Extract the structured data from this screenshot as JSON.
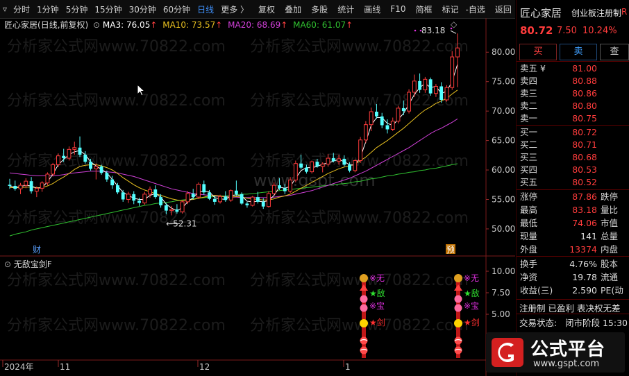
{
  "toolbar": {
    "items": [
      {
        "label": "分时",
        "active": false
      },
      {
        "label": "1分钟",
        "active": false
      },
      {
        "label": "5分钟",
        "active": false
      },
      {
        "label": "15分钟",
        "active": false
      },
      {
        "label": "30分钟",
        "active": false
      },
      {
        "label": "60分钟",
        "active": false
      },
      {
        "label": "日线",
        "active": true
      },
      {
        "label": "更多 〉",
        "active": false
      }
    ],
    "right_items": [
      "复权",
      "叠加",
      "多股",
      "统计",
      "画线",
      "F10",
      "简框",
      "标记",
      "-自选",
      "返回"
    ]
  },
  "chart_header": {
    "stock": "匠心家居",
    "mode": "(日线,前复权)",
    "ma3": "MA3: 76.05",
    "ma10": "MA10: 73.57",
    "ma20": "MA20: 68.69",
    "ma60": "MA60: 61.07",
    "colors": {
      "ma3": "#ffffff",
      "ma10": "#e8c020",
      "ma20": "#d040d8",
      "ma60": "#30c030"
    }
  },
  "chart_data": {
    "type": "candlestick",
    "y_ticks": [
      "80.00",
      "75.00",
      "70.00",
      "65.00",
      "60.00",
      "55.00",
      "50.00"
    ],
    "ylim": [
      45.4,
      85.8
    ],
    "annotations": {
      "high": "83.18",
      "low": "52.31"
    },
    "x_ticks": [
      "2024年",
      "11",
      "12",
      "1"
    ],
    "markers": {
      "fin": "财",
      "pre": "预"
    },
    "ohlc": [
      [
        57.5,
        58.5,
        56.8,
        57.3
      ],
      [
        57.3,
        58.2,
        56.5,
        56.8
      ],
      [
        56.8,
        57.8,
        55.9,
        57.4
      ],
      [
        57.4,
        58.6,
        56.9,
        58.1
      ],
      [
        58.1,
        58.8,
        56.0,
        56.4
      ],
      [
        56.4,
        57.2,
        55.4,
        56.9
      ],
      [
        56.9,
        58.1,
        56.3,
        57.8
      ],
      [
        57.8,
        59.6,
        57.4,
        59.3
      ],
      [
        59.3,
        61.2,
        58.9,
        60.9
      ],
      [
        60.9,
        62.8,
        60.5,
        62.4
      ],
      [
        62.4,
        63.6,
        61.4,
        62.0
      ],
      [
        62.0,
        64.0,
        61.6,
        63.5
      ],
      [
        63.5,
        64.8,
        62.6,
        63.8
      ],
      [
        63.8,
        65.7,
        62.2,
        62.6
      ],
      [
        62.6,
        63.2,
        61.1,
        61.4
      ],
      [
        61.4,
        61.9,
        59.9,
        60.2
      ],
      [
        60.2,
        61.1,
        58.4,
        60.6
      ],
      [
        60.6,
        60.9,
        59.2,
        59.5
      ],
      [
        59.5,
        59.9,
        58.0,
        58.4
      ],
      [
        58.4,
        59.0,
        56.8,
        57.4
      ],
      [
        57.4,
        57.8,
        55.9,
        56.2
      ],
      [
        56.2,
        56.6,
        54.6,
        55.0
      ],
      [
        55.0,
        56.3,
        54.4,
        55.9
      ],
      [
        55.9,
        56.4,
        54.2,
        54.8
      ],
      [
        54.8,
        55.3,
        53.9,
        54.4
      ],
      [
        54.4,
        56.3,
        54.1,
        55.9
      ],
      [
        55.9,
        57.2,
        55.3,
        56.7
      ],
      [
        56.7,
        57.4,
        55.1,
        55.4
      ],
      [
        55.4,
        55.9,
        53.6,
        54.0
      ],
      [
        54.0,
        54.4,
        52.5,
        53.1
      ],
      [
        53.1,
        53.9,
        52.3,
        53.3
      ],
      [
        53.3,
        54.2,
        52.6,
        52.9
      ],
      [
        52.9,
        54.9,
        52.6,
        54.6
      ],
      [
        54.6,
        56.4,
        54.2,
        56.0
      ],
      [
        56.0,
        56.8,
        55.0,
        55.4
      ],
      [
        55.4,
        57.9,
        55.1,
        57.6
      ],
      [
        57.6,
        58.2,
        55.8,
        56.2
      ],
      [
        56.2,
        56.6,
        54.9,
        55.1
      ],
      [
        55.1,
        55.6,
        54.1,
        54.6
      ],
      [
        54.6,
        55.8,
        54.3,
        55.5
      ],
      [
        55.5,
        56.4,
        54.6,
        54.9
      ],
      [
        54.9,
        56.7,
        54.6,
        56.5
      ],
      [
        56.5,
        58.2,
        55.6,
        55.9
      ],
      [
        55.9,
        56.2,
        54.1,
        54.3
      ],
      [
        54.3,
        54.6,
        53.6,
        54.0
      ],
      [
        54.0,
        55.6,
        53.8,
        55.4
      ],
      [
        55.4,
        56.3,
        54.3,
        54.6
      ],
      [
        54.6,
        55.2,
        53.4,
        53.8
      ],
      [
        53.8,
        56.4,
        53.6,
        56.0
      ],
      [
        56.0,
        57.9,
        55.8,
        57.4
      ],
      [
        57.4,
        58.6,
        56.6,
        56.9
      ],
      [
        56.9,
        57.6,
        55.9,
        56.4
      ],
      [
        56.4,
        58.8,
        56.1,
        58.3
      ],
      [
        58.3,
        61.6,
        57.9,
        61.1
      ],
      [
        61.1,
        62.6,
        60.1,
        60.4
      ],
      [
        60.4,
        60.9,
        59.4,
        59.7
      ],
      [
        59.7,
        61.6,
        59.4,
        61.4
      ],
      [
        61.4,
        61.9,
        60.4,
        60.6
      ],
      [
        60.6,
        61.3,
        59.6,
        61.0
      ],
      [
        61.0,
        62.7,
        60.6,
        62.0
      ],
      [
        62.0,
        62.9,
        61.3,
        61.5
      ],
      [
        61.5,
        62.6,
        60.9,
        61.9
      ],
      [
        61.9,
        62.5,
        60.6,
        60.9
      ],
      [
        60.9,
        61.3,
        59.6,
        59.9
      ],
      [
        59.9,
        61.8,
        59.6,
        61.6
      ],
      [
        61.6,
        65.6,
        61.2,
        65.1
      ],
      [
        65.1,
        68.3,
        64.6,
        67.7
      ],
      [
        67.7,
        70.6,
        66.6,
        69.9
      ],
      [
        69.9,
        71.2,
        68.7,
        69.1
      ],
      [
        69.1,
        69.7,
        67.1,
        67.6
      ],
      [
        67.6,
        68.6,
        66.2,
        66.9
      ],
      [
        66.9,
        68.9,
        66.6,
        68.3
      ],
      [
        68.3,
        70.9,
        67.9,
        70.5
      ],
      [
        70.5,
        71.8,
        69.3,
        70.0
      ],
      [
        70.0,
        73.7,
        69.6,
        73.2
      ],
      [
        73.2,
        76.2,
        72.4,
        75.1
      ],
      [
        75.1,
        76.4,
        73.1,
        73.6
      ],
      [
        73.6,
        75.8,
        73.1,
        75.4
      ],
      [
        75.4,
        75.7,
        72.6,
        73.0
      ],
      [
        73.0,
        74.6,
        72.4,
        74.2
      ],
      [
        74.2,
        74.9,
        71.4,
        71.9
      ],
      [
        71.9,
        74.4,
        71.6,
        74.0
      ],
      [
        74.0,
        80.2,
        73.6,
        79.2
      ],
      [
        79.2,
        83.18,
        74.06,
        80.72
      ]
    ],
    "ma_series": {
      "ma3": [
        57.3,
        57.0,
        57.2,
        57.4,
        57.3,
        56.9,
        57.0,
        58.0,
        59.3,
        60.9,
        61.8,
        62.6,
        63.1,
        63.3,
        62.6,
        61.4,
        60.7,
        60.1,
        59.5,
        58.4,
        57.3,
        56.2,
        55.7,
        55.2,
        55.0,
        55.0,
        55.7,
        56.0,
        55.4,
        54.2,
        53.5,
        53.1,
        53.6,
        54.6,
        55.3,
        56.3,
        56.4,
        56.3,
        55.3,
        55.1,
        55.0,
        55.6,
        55.8,
        55.6,
        54.7,
        54.6,
        54.7,
        54.6,
        54.8,
        55.7,
        57.1,
        56.9,
        57.2,
        58.6,
        59.9,
        60.4,
        60.4,
        60.6,
        61.0,
        61.2,
        61.5,
        61.8,
        61.4,
        60.9,
        60.8,
        62.2,
        64.8,
        67.6,
        68.9,
        68.9,
        67.9,
        67.6,
        68.6,
        69.6,
        71.2,
        72.8,
        74.0,
        74.7,
        74.0,
        74.2,
        73.0,
        73.4,
        75.0,
        77.97
      ],
      "ma10": [
        57.0,
        57.0,
        57.0,
        57.1,
        57.1,
        57.0,
        57.0,
        57.3,
        57.7,
        58.3,
        58.8,
        59.4,
        60.1,
        60.6,
        60.8,
        60.9,
        60.9,
        60.7,
        60.4,
        60.0,
        59.4,
        58.7,
        58.1,
        57.5,
        57.0,
        56.6,
        56.3,
        56.0,
        55.7,
        55.4,
        55.1,
        54.9,
        54.8,
        54.9,
        55.0,
        55.2,
        55.4,
        55.6,
        55.7,
        55.6,
        55.4,
        55.4,
        55.5,
        55.4,
        55.2,
        55.1,
        55.0,
        54.9,
        54.9,
        55.1,
        55.4,
        55.6,
        55.9,
        56.4,
        56.9,
        57.4,
        57.9,
        58.4,
        58.9,
        59.4,
        59.8,
        60.2,
        60.5,
        60.7,
        61.0,
        61.6,
        62.2,
        63.0,
        63.8,
        64.4,
        65.0,
        65.7,
        66.4,
        67.1,
        67.9,
        68.7,
        69.5,
        70.2,
        70.7,
        71.3,
        71.7,
        72.2,
        72.9,
        73.57
      ],
      "ma20": [
        59.5,
        59.4,
        59.3,
        59.2,
        59.1,
        59.0,
        59.0,
        59.0,
        59.0,
        59.1,
        59.2,
        59.4,
        59.5,
        59.6,
        59.7,
        59.8,
        59.8,
        59.8,
        59.7,
        59.6,
        59.5,
        59.3,
        59.1,
        58.9,
        58.6,
        58.3,
        58.0,
        57.7,
        57.4,
        57.1,
        56.8,
        56.6,
        56.4,
        56.2,
        56.0,
        55.9,
        55.8,
        55.7,
        55.6,
        55.5,
        55.5,
        55.4,
        55.4,
        55.3,
        55.3,
        55.3,
        55.3,
        55.3,
        55.3,
        55.4,
        55.5,
        55.6,
        55.7,
        55.9,
        56.1,
        56.3,
        56.5,
        56.8,
        57.1,
        57.4,
        57.7,
        58.0,
        58.3,
        58.6,
        59.0,
        59.4,
        59.8,
        60.3,
        60.8,
        61.3,
        61.8,
        62.3,
        62.8,
        63.3,
        63.8,
        64.4,
        65.0,
        65.6,
        66.2,
        66.7,
        67.1,
        67.6,
        68.1,
        68.69
      ],
      "ma60": [
        48.8,
        49.1,
        49.3,
        49.5,
        49.8,
        50.0,
        50.2,
        50.4,
        50.6,
        50.8,
        51.0,
        51.2,
        51.4,
        51.6,
        51.8,
        52.0,
        52.2,
        52.4,
        52.6,
        52.8,
        53.0,
        53.2,
        53.4,
        53.6,
        53.8,
        54.0,
        54.1,
        54.3,
        54.4,
        54.5,
        54.6,
        54.8,
        54.9,
        55.0,
        55.1,
        55.2,
        55.3,
        55.4,
        55.5,
        55.6,
        55.6,
        55.7,
        55.8,
        55.9,
        55.9,
        56.0,
        56.1,
        56.2,
        56.3,
        56.4,
        56.5,
        56.6,
        56.7,
        56.8,
        56.9,
        57.0,
        57.1,
        57.2,
        57.3,
        57.4,
        57.5,
        57.6,
        57.7,
        57.8,
        58.0,
        58.1,
        58.3,
        58.5,
        58.6,
        58.8,
        59.0,
        59.1,
        59.3,
        59.4,
        59.6,
        59.7,
        59.9,
        60.0,
        60.2,
        60.3,
        60.5,
        60.7,
        60.9,
        61.07
      ]
    }
  },
  "indicator_panel": {
    "title": "无敌宝剑F",
    "y_ticks": [
      "10.00",
      "7.50",
      "5.00"
    ],
    "signal_labels": [
      "※无",
      "★敌",
      "※宝",
      "★剑"
    ],
    "signal_colors": [
      "#e030e0",
      "#30e030",
      "#e030e0",
      "#ff3030"
    ]
  },
  "right_panel": {
    "name": "匠心家居",
    "board": "创业板注册制",
    "board_flag": "R",
    "price": "80.72",
    "change": "7.50",
    "change_pct": "10.24%",
    "buy_btn": "买",
    "sell_btn": "卖",
    "query_btn": "查",
    "asks": [
      {
        "label": "卖五",
        "extra": "¥",
        "price": "81.00",
        "vol": ""
      },
      {
        "label": "卖四",
        "extra": "",
        "price": "80.88",
        "vol": ""
      },
      {
        "label": "卖三",
        "extra": "",
        "price": "80.86",
        "vol": ""
      },
      {
        "label": "卖二",
        "extra": "",
        "price": "80.80",
        "vol": ""
      },
      {
        "label": "卖一",
        "extra": "",
        "price": "80.75",
        "vol": ""
      }
    ],
    "bids": [
      {
        "label": "买一",
        "price": "80.72"
      },
      {
        "label": "买二",
        "price": "80.71"
      },
      {
        "label": "买三",
        "price": "80.68"
      },
      {
        "label": "买四",
        "price": "80.53"
      },
      {
        "label": "买五",
        "price": "80.52"
      }
    ],
    "stats1": [
      {
        "label": "涨停",
        "value": "87.86",
        "color": "red",
        "label2": "跌停"
      },
      {
        "label": "最高",
        "value": "83.18",
        "color": "red",
        "label2": "量比"
      },
      {
        "label": "最低",
        "value": "74.06",
        "color": "red",
        "label2": "市值"
      },
      {
        "label": "现量",
        "value": "141",
        "color": "wht",
        "label2": "总量"
      },
      {
        "label": "外盘",
        "value": "13374",
        "color": "red",
        "label2": "内盘"
      }
    ],
    "stats2": [
      {
        "label": "换手",
        "value": "4.76%",
        "label2": "股本"
      },
      {
        "label": "净资",
        "value": "19.78",
        "label2": "流通"
      },
      {
        "label": "收益(三)",
        "value": "2.590",
        "label2": "PE(动"
      }
    ],
    "tags": "注册制 已盈利 表决权无差",
    "trade_status_label": "交易状态:",
    "trade_status_value": "闭市阶段 15:30"
  },
  "watermark": {
    "text": "分析家公式网www.70822.com",
    "center": "www.gspt.com",
    "logo_title": "公式平台",
    "logo_url": "www.gspt.com"
  }
}
